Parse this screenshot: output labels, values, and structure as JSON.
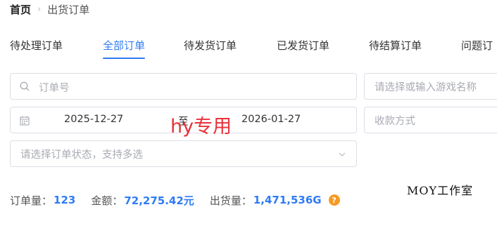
{
  "breadcrumb": {
    "home": "首页",
    "separator": "›",
    "current": "出货订单"
  },
  "tabs": [
    {
      "label": "待处理订单",
      "active": false
    },
    {
      "label": "全部订单",
      "active": true
    },
    {
      "label": "待发货订单",
      "active": false
    },
    {
      "label": "已发货订单",
      "active": false
    },
    {
      "label": "待结算订单",
      "active": false
    },
    {
      "label": "问题订",
      "active": false
    }
  ],
  "filters": {
    "order_placeholder": "订单号",
    "game_placeholder": "请选择或输入游戏名称",
    "date_start": "2025-12-27",
    "date_separator": "至",
    "date_end": "2026-01-27",
    "payment_placeholder": "收款方式",
    "status_placeholder": "请选择订单状态，支持多选"
  },
  "watermark": "hy专用",
  "stats": {
    "orders_label": "订单量：",
    "orders_value": "123",
    "amount_label": "金额：",
    "amount_value": "72,275.42元",
    "shipped_label": "出货量：",
    "shipped_value": "1,471,536G",
    "help_glyph": "?"
  },
  "studio_mark": "MOY工作室",
  "colors": {
    "accent": "#2f7bf5",
    "watermark": "#e8313a",
    "help": "#f59a23"
  }
}
